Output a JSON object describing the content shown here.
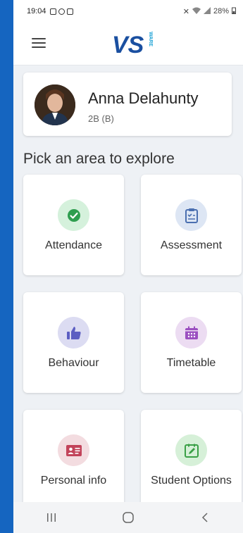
{
  "status_bar": {
    "time": "19:04",
    "battery": "28%"
  },
  "header": {
    "menu_icon": "hamburger-menu-icon",
    "logo_text": "VS",
    "logo_sub": "WARE",
    "logo_color": "#1a4fa0",
    "logo_accent": "#1fa3d6"
  },
  "profile": {
    "name": "Anna Delahunty",
    "class": "2B (B)"
  },
  "section_title": "Pick an area to explore",
  "tiles": [
    {
      "label": "Attendance",
      "icon": "check-circle-icon",
      "bg": "#d5f1dc",
      "fg": "#2e9e4f"
    },
    {
      "label": "Assessment",
      "icon": "clipboard-icon",
      "bg": "#dde6f4",
      "fg": "#4a6fb0"
    },
    {
      "label": "Behaviour",
      "icon": "thumbs-up-icon",
      "bg": "#dcdcf2",
      "fg": "#5c5ec2"
    },
    {
      "label": "Timetable",
      "icon": "calendar-icon",
      "bg": "#ecdcf2",
      "fg": "#9b4fc0"
    },
    {
      "label": "Personal info",
      "icon": "id-card-icon",
      "bg": "#f3dce0",
      "fg": "#c2435a"
    },
    {
      "label": "Student Options",
      "icon": "edit-note-icon",
      "bg": "#d6f0d8",
      "fg": "#3aa046"
    }
  ],
  "nav_bar": {
    "recents_icon": "recents-icon",
    "home_icon": "home-icon",
    "back_icon": "back-icon"
  }
}
